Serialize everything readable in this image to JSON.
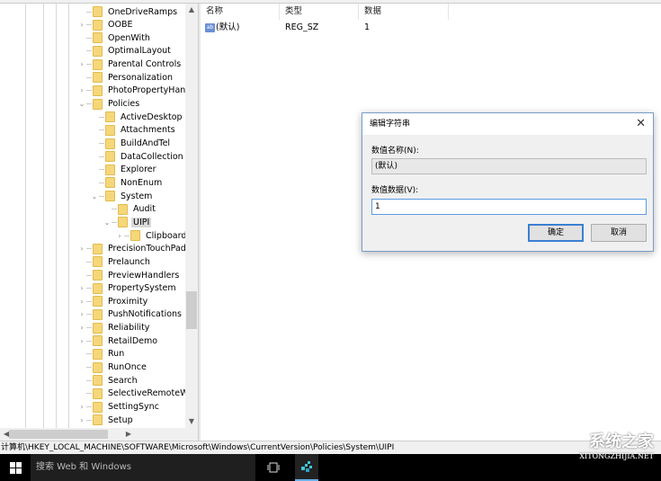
{
  "tree": {
    "items": [
      {
        "label": "OneDriveRamps",
        "level": 1,
        "expander": "none"
      },
      {
        "label": "OOBE",
        "level": 1,
        "expander": "collapsed"
      },
      {
        "label": "OpenWith",
        "level": 1,
        "expander": "none"
      },
      {
        "label": "OptimalLayout",
        "level": 1,
        "expander": "none"
      },
      {
        "label": "Parental Controls",
        "level": 1,
        "expander": "collapsed"
      },
      {
        "label": "Personalization",
        "level": 1,
        "expander": "none"
      },
      {
        "label": "PhotoPropertyHandle",
        "level": 1,
        "expander": "collapsed"
      },
      {
        "label": "Policies",
        "level": 1,
        "expander": "expanded"
      },
      {
        "label": "ActiveDesktop",
        "level": 2,
        "expander": "none"
      },
      {
        "label": "Attachments",
        "level": 2,
        "expander": "none"
      },
      {
        "label": "BuildAndTel",
        "level": 2,
        "expander": "none"
      },
      {
        "label": "DataCollection",
        "level": 2,
        "expander": "none"
      },
      {
        "label": "Explorer",
        "level": 2,
        "expander": "none"
      },
      {
        "label": "NonEnum",
        "level": 2,
        "expander": "none"
      },
      {
        "label": "System",
        "level": 2,
        "expander": "expanded"
      },
      {
        "label": "Audit",
        "level": 3,
        "expander": "none"
      },
      {
        "label": "UIPI",
        "level": 3,
        "expander": "expanded",
        "selected": true
      },
      {
        "label": "Clipboard",
        "level": 4,
        "expander": "collapsed"
      },
      {
        "label": "PrecisionTouchPad",
        "level": 1,
        "expander": "collapsed"
      },
      {
        "label": "Prelaunch",
        "level": 1,
        "expander": "none"
      },
      {
        "label": "PreviewHandlers",
        "level": 1,
        "expander": "none"
      },
      {
        "label": "PropertySystem",
        "level": 1,
        "expander": "collapsed"
      },
      {
        "label": "Proximity",
        "level": 1,
        "expander": "collapsed"
      },
      {
        "label": "PushNotifications",
        "level": 1,
        "expander": "collapsed"
      },
      {
        "label": "Reliability",
        "level": 1,
        "expander": "collapsed"
      },
      {
        "label": "RetailDemo",
        "level": 1,
        "expander": "collapsed"
      },
      {
        "label": "Run",
        "level": 1,
        "expander": "none"
      },
      {
        "label": "RunOnce",
        "level": 1,
        "expander": "none"
      },
      {
        "label": "Search",
        "level": 1,
        "expander": "none"
      },
      {
        "label": "SelectiveRemoteWipe",
        "level": 1,
        "expander": "none"
      },
      {
        "label": "SettingSync",
        "level": 1,
        "expander": "collapsed"
      },
      {
        "label": "Setup",
        "level": 1,
        "expander": "collapsed"
      }
    ]
  },
  "list": {
    "columns": [
      "名称",
      "类型",
      "数据"
    ],
    "rows": [
      {
        "icon": "ab",
        "name": "(默认)",
        "type": "REG_SZ",
        "data": "1"
      }
    ]
  },
  "status_path": "计算机\\HKEY_LOCAL_MACHINE\\SOFTWARE\\Microsoft\\Windows\\CurrentVersion\\Policies\\System\\UIPI",
  "dialog": {
    "title": "编辑字符串",
    "name_label": "数值名称(N):",
    "name_value": "(默认)",
    "data_label": "数值数据(V):",
    "data_value": "1",
    "ok": "确定",
    "cancel": "取消"
  },
  "taskbar": {
    "search_placeholder": "搜索 Web 和 Windows",
    "accent": "#6ab0e8"
  },
  "watermark": {
    "line1": "系统之家",
    "line2": "XITONGZHIJIA.NET"
  }
}
